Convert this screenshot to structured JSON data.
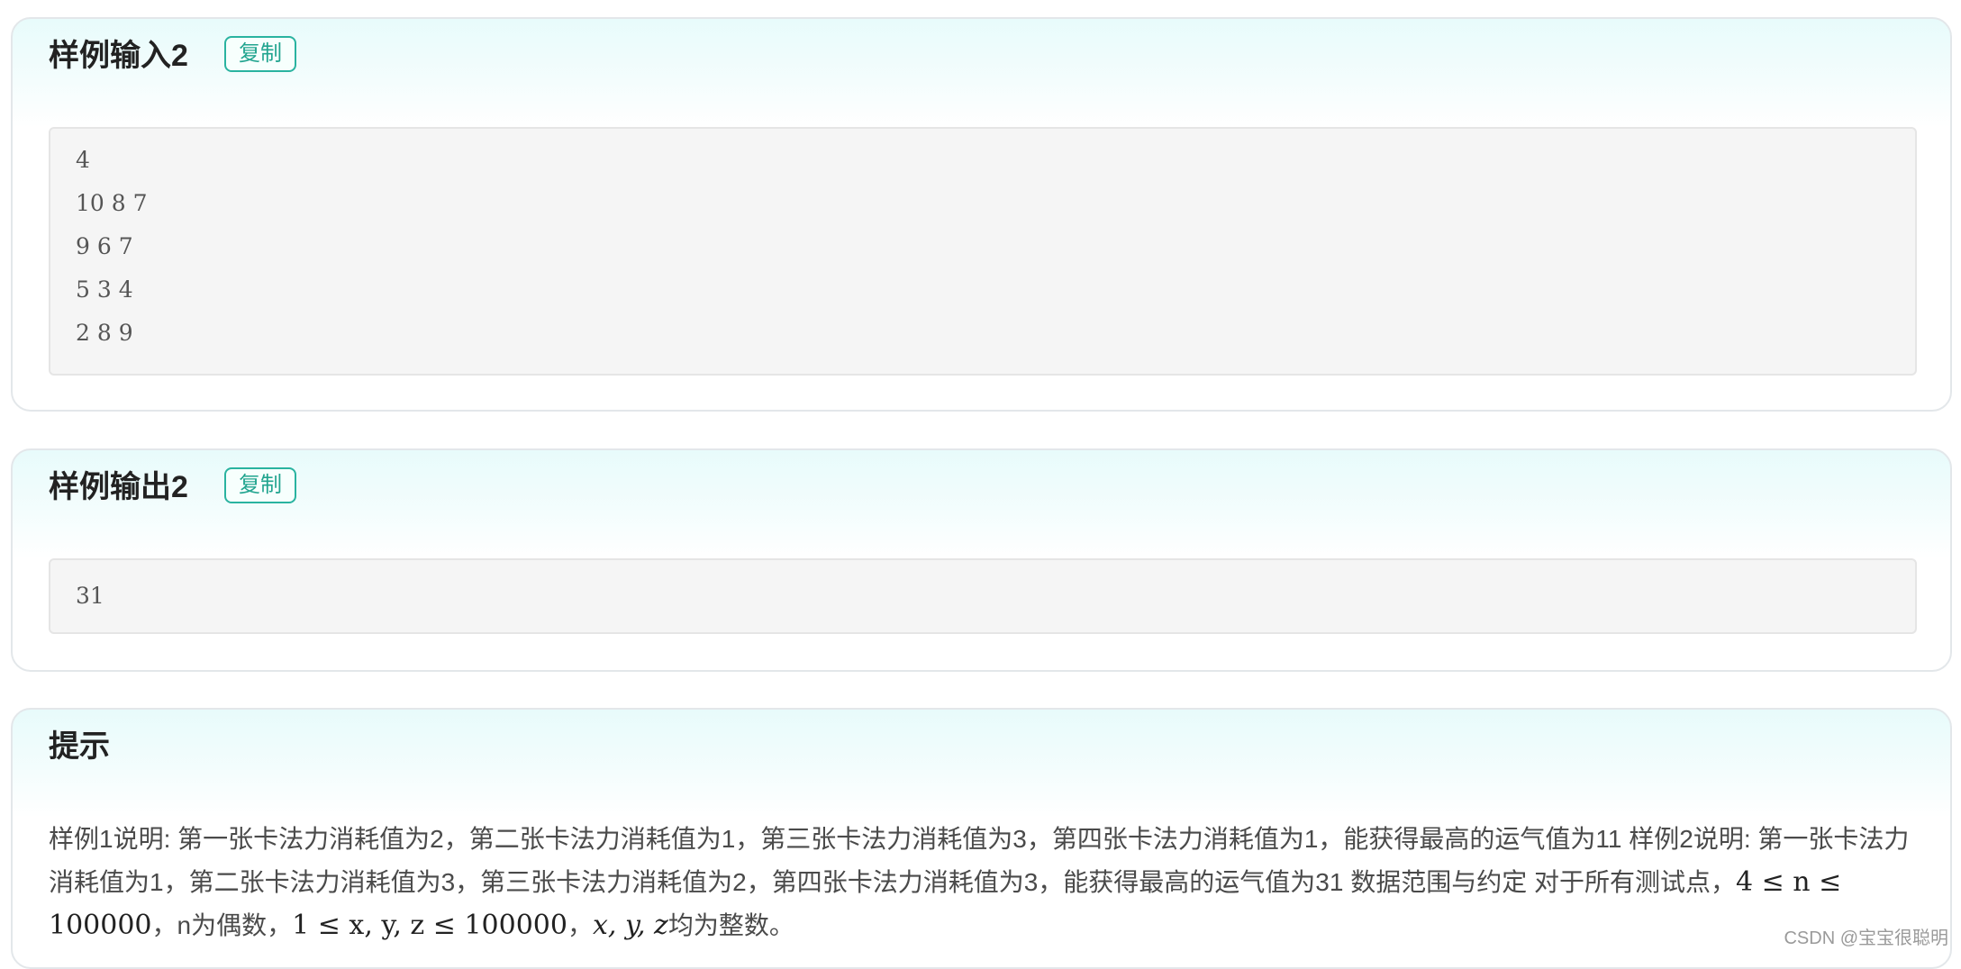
{
  "sample_input": {
    "title": "样例输入2",
    "copy_label": "复制",
    "lines": [
      "4",
      "10 8 7",
      "9 6 7",
      "5 3 4",
      "2 8 9"
    ]
  },
  "sample_output": {
    "title": "样例输出2",
    "copy_label": "复制",
    "lines": [
      "31"
    ]
  },
  "hint": {
    "title": "提示",
    "text_part1": "样例1说明: 第一张卡法力消耗值为2，第二张卡法力消耗值为1，第三张卡法力消耗值为3，第四张卡法力消耗值为1，能获得最高的运气值为11 样例2说明: 第一张卡法力消耗值为1，第二张卡法力消耗值为3，第三张卡法力消耗值为2，第四张卡法力消耗值为3，能获得最高的运气值为31 数据范围与约定 对于所有测试点，",
    "math1": "4 ≤ n ≤ 100000",
    "text_part2": "，n为偶数，",
    "math2": "1 ≤ x, y, z ≤ 100000",
    "text_part3": "，",
    "math3": "x, y, z",
    "text_part4": "均为整数。"
  },
  "watermark": "CSDN @宝宝很聪明",
  "colors": {
    "accent": "#2ab3a0",
    "card_header_tint": "#e8fbfb",
    "code_bg": "#f5f5f5"
  }
}
